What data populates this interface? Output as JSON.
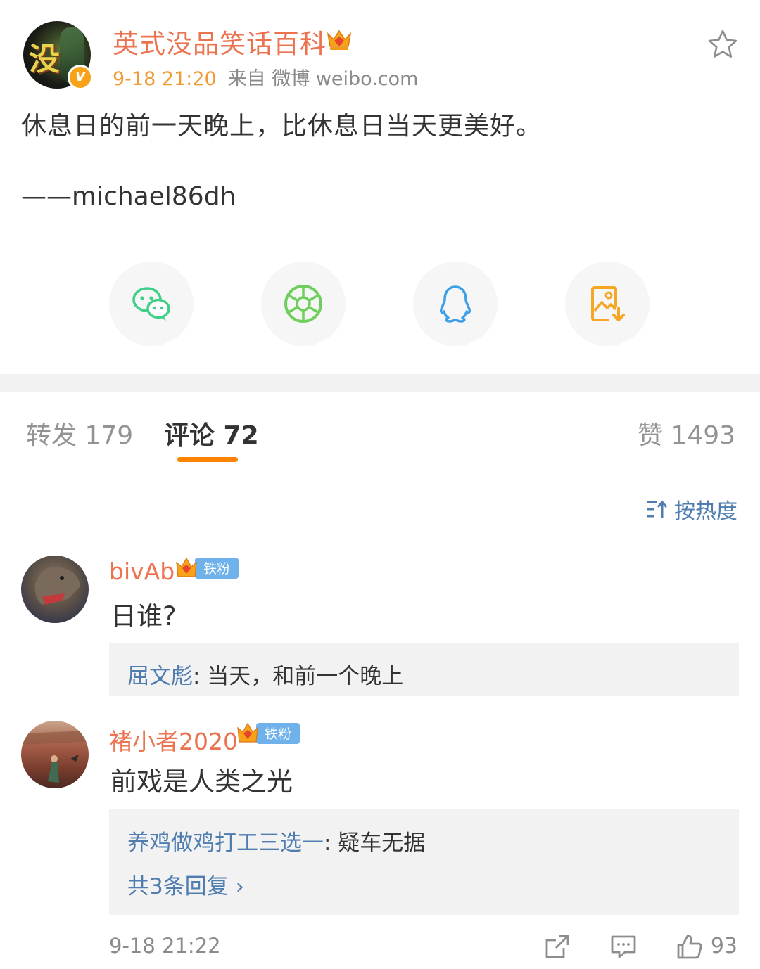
{
  "post": {
    "author": "英式没品笑话百科",
    "avatar_icon": "masked-character-avatar",
    "avatar_glyph": "没",
    "verified_icon": "v-badge-icon",
    "verified_mark": "V",
    "member_icon": "crown-icon",
    "time": "9-18 21:20",
    "source": "来自 微博 weibo.com",
    "text": "休息日的前一天晚上，比休息日当天更美好。",
    "signature": "——michael86dh",
    "favorite_icon": "star-icon"
  },
  "share": [
    {
      "name": "wechat",
      "icon": "wechat-icon",
      "color": "#3fcf86"
    },
    {
      "name": "moments",
      "icon": "aperture-icon",
      "color": "#6fcf5c"
    },
    {
      "name": "qq",
      "icon": "qq-penguin-icon",
      "color": "#3d9fe6"
    },
    {
      "name": "save-image",
      "icon": "save-image-icon",
      "color": "#f5a623"
    }
  ],
  "tabs": {
    "repost": "转发 179",
    "comment": "评论 72",
    "like": "赞 1493"
  },
  "sort": {
    "label": "按热度",
    "icon": "sort-icon"
  },
  "comments": [
    {
      "user": "bivAb",
      "badge": "铁粉",
      "text": "日谁?",
      "reply": {
        "user": "屈文彪",
        "text": ": 当天，和前一个晚上"
      }
    },
    {
      "user": "褚小者2020",
      "badge": "铁粉",
      "text": "前戏是人类之光",
      "reply": {
        "user": "养鸡做鸡打工三选一",
        "text": ": 疑车无据"
      },
      "more_replies": "共3条回复 ›",
      "time": "9-18 21:22",
      "like_count": "93"
    }
  ],
  "colors": {
    "accent_orange": "#ff8200",
    "name_orange": "#eb7350",
    "link_blue": "#507daf"
  }
}
